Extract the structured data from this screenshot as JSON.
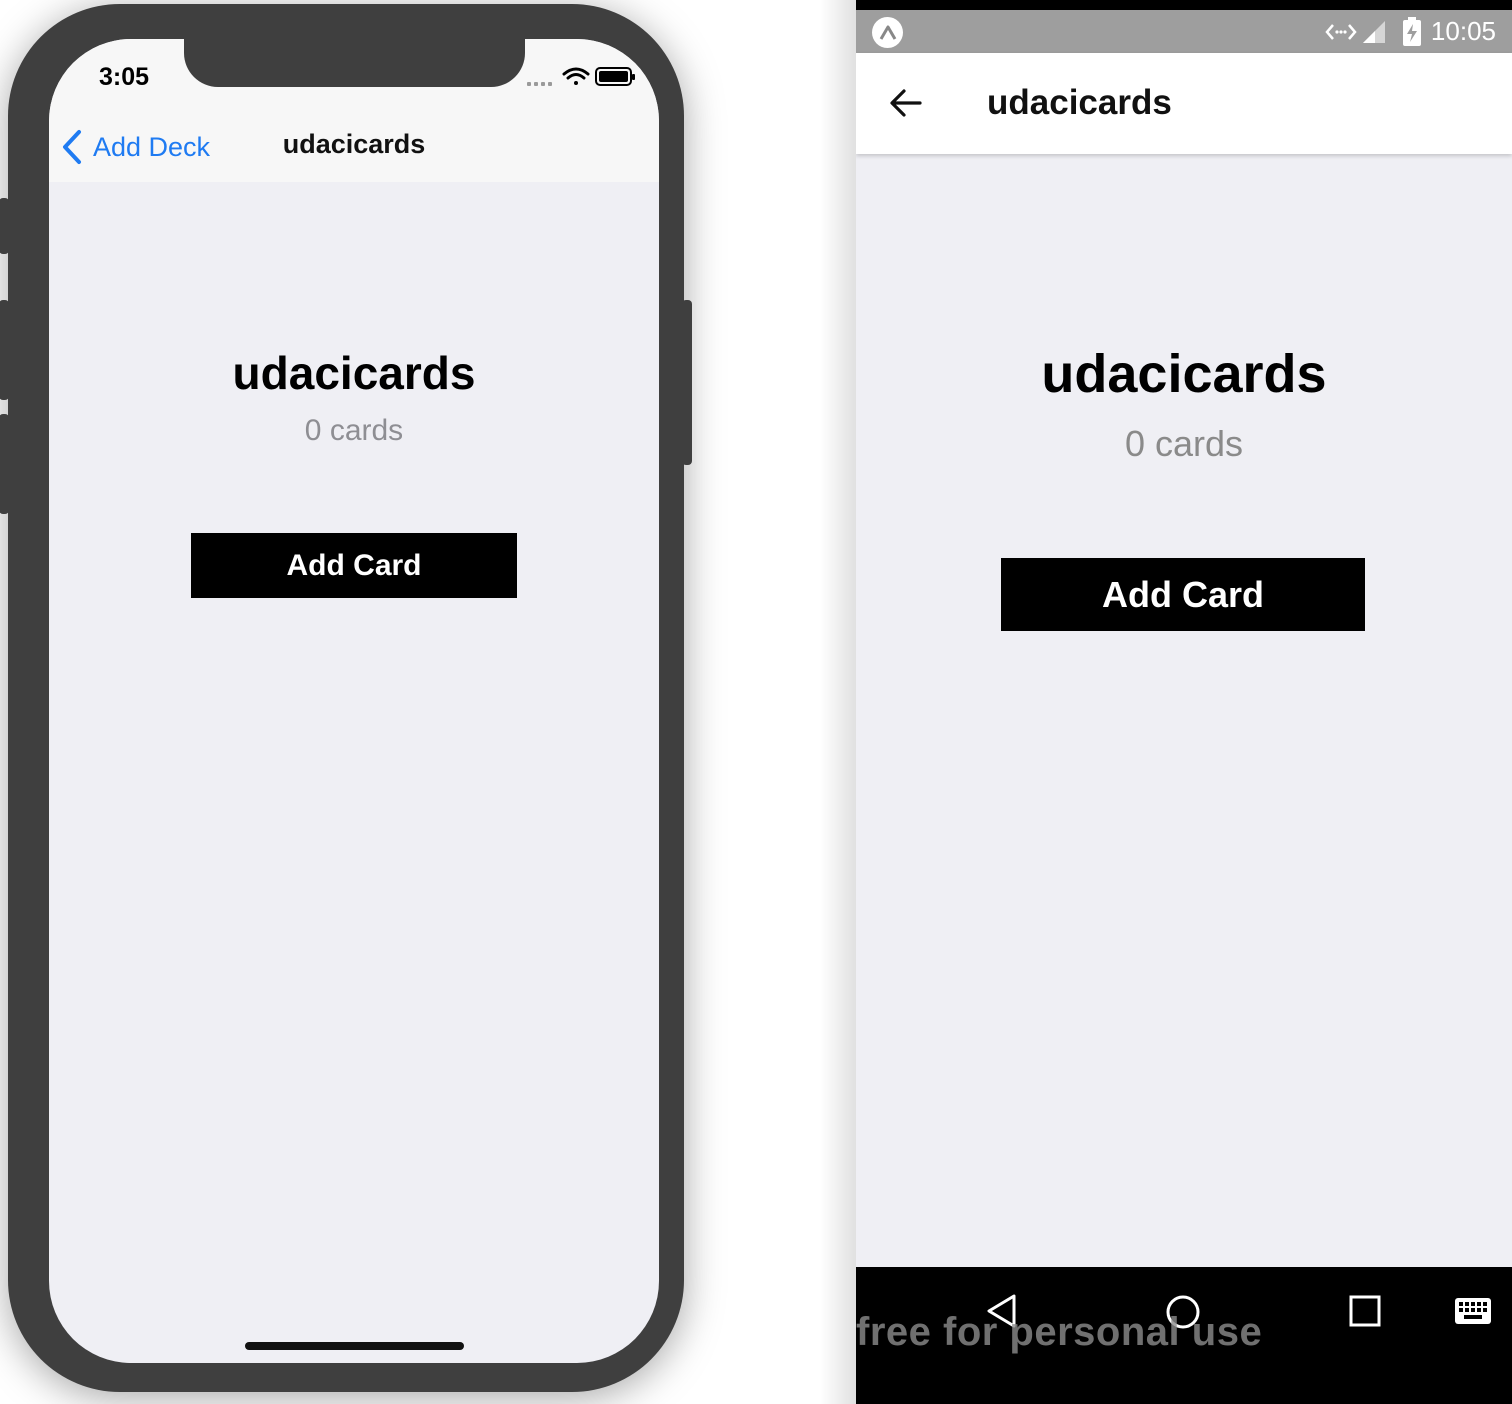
{
  "ios": {
    "status_time": "3:05",
    "nav": {
      "back_label": "Add Deck",
      "title": "udacicards"
    },
    "deck": {
      "title": "udacicards",
      "count": "0 cards"
    },
    "add_card_label": "Add Card",
    "colors": {
      "accent": "#1f7bf2",
      "background": "#efeff4",
      "frame": "#3f3f3f"
    },
    "icons": [
      "chevron-left-icon",
      "signal-dots-icon",
      "wifi-icon",
      "battery-icon"
    ]
  },
  "android": {
    "status_time": "10:05",
    "appbar": {
      "title": "udacicards"
    },
    "deck": {
      "title": "udacicards",
      "count": "0 cards"
    },
    "add_card_label": "Add Card",
    "watermark": "free for personal use",
    "icons": [
      "expo-icon",
      "code-arrows-icon",
      "signal-icon",
      "battery-charging-icon",
      "arrow-left-icon",
      "nav-back-icon",
      "nav-home-icon",
      "nav-recents-icon",
      "keyboard-icon"
    ],
    "colors": {
      "statusbar": "#9e9e9e",
      "navbar": "#000000"
    }
  }
}
